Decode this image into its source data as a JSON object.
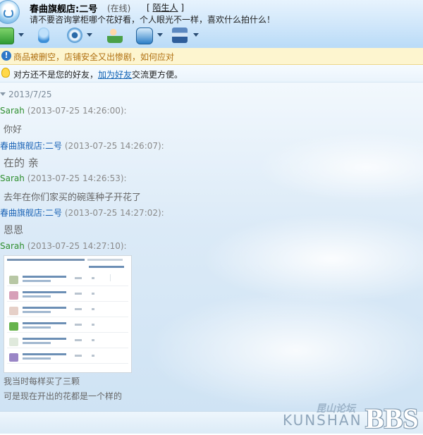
{
  "header": {
    "contact_name": "春曲旗舰店:二号",
    "contact_status": "(在线)",
    "stranger_tag": "陌生人",
    "signature": "请不要咨询掌柜哪个花好看，个人眼光不一样，喜欢什么拍什么！"
  },
  "toolbar": {
    "items": [
      {
        "icon": "video-call-icon",
        "color": "#3aa63a"
      },
      {
        "icon": "microphone-icon",
        "color": "#3c8fd8"
      },
      {
        "icon": "camera-icon",
        "color": "#6aa9dc"
      },
      {
        "icon": "add-contact-icon",
        "color": "#4aa047"
      },
      {
        "icon": "remote-assist-icon",
        "color": "#2b7fc7"
      },
      {
        "icon": "shop-icon",
        "color": "#2e5d9a"
      }
    ]
  },
  "notice": {
    "text": "商品被删空，店铺安全又出惨剧，如何应对"
  },
  "friend_tip": {
    "prefix": "对方还不是您的好友，",
    "link": "加为好友",
    "suffix": "交流更方便。"
  },
  "chat": {
    "date": "2013/7/25",
    "messages": [
      {
        "sender": "Sarah",
        "time": "(2013-07-25 14:26:00):",
        "text": "你好"
      },
      {
        "sender": "春曲旗舰店:二号",
        "time": "(2013-07-25 14:26:07):",
        "text": "在的 亲"
      },
      {
        "sender": "Sarah",
        "time": "(2013-07-25 14:26:53):",
        "text": "去年在你们家买的碗莲种子开花了"
      },
      {
        "sender": "春曲旗舰店:二号",
        "time": "(2013-07-25 14:27:02):",
        "text": "恩恩"
      },
      {
        "sender": "Sarah",
        "time": "(2013-07-25 14:27:10):",
        "text": ""
      }
    ],
    "after_image_lines": [
      "我当时每样买了三颗",
      "可是现在开出的花都是一个样的"
    ]
  },
  "watermark": {
    "cn": "昆山论坛",
    "en": "KUNSHAN",
    "bbs": "BBS"
  },
  "colors": {
    "sender_customer": "#2f8f2f",
    "sender_shop": "#1b63b6",
    "notice_text": "#b07011"
  }
}
